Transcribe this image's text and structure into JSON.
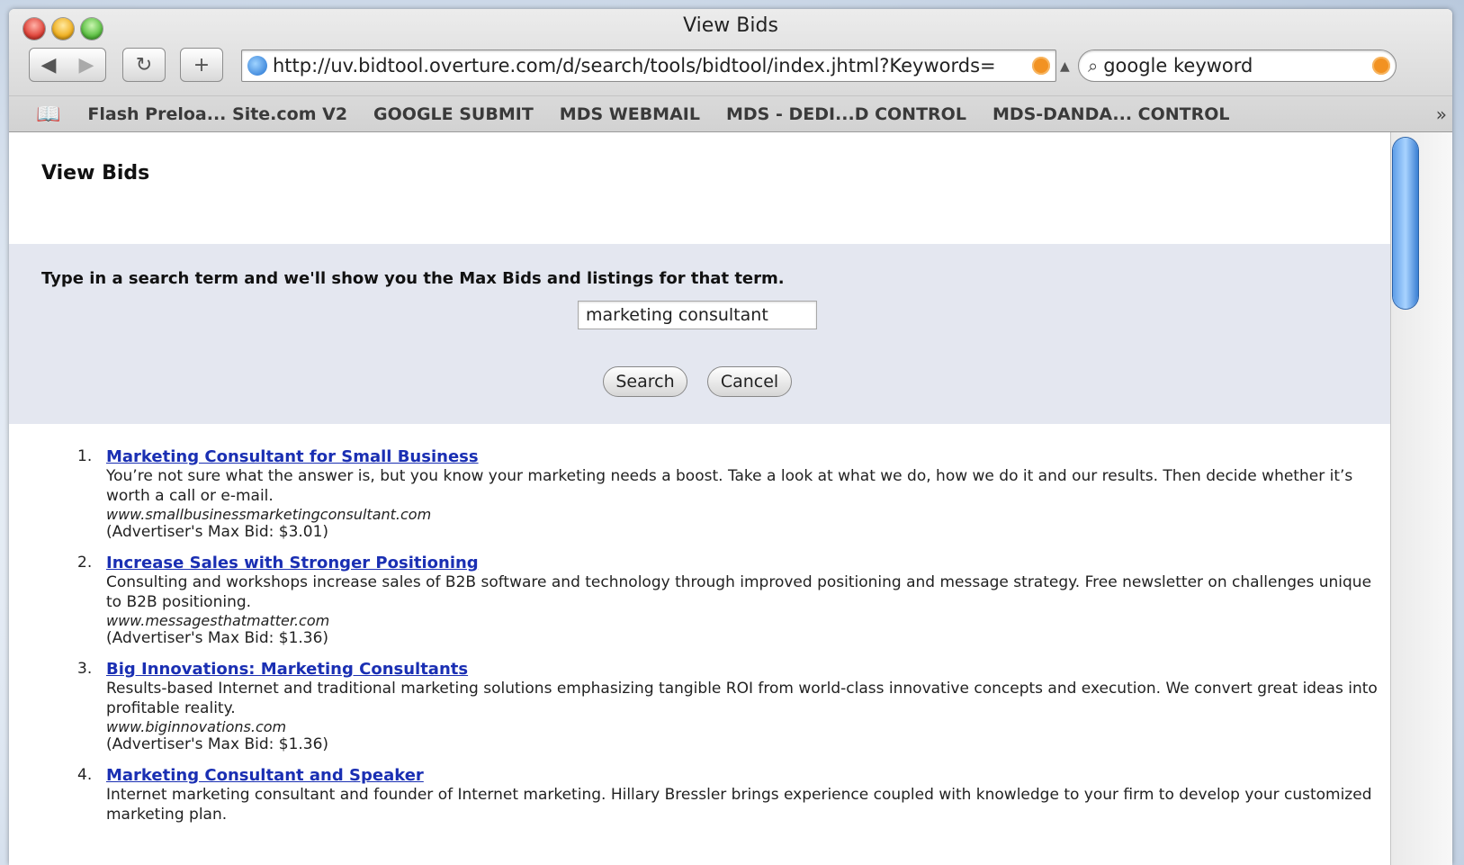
{
  "window": {
    "title": "View Bids"
  },
  "toolbar": {
    "url": "http://uv.bidtool.overture.com/d/search/tools/bidtool/index.jhtml?Keywords=",
    "search_value": "google keyword"
  },
  "bookmarks": [
    "Flash Preloa... Site.com V2",
    "GOOGLE SUBMIT",
    "MDS WEBMAIL",
    "MDS - DEDI...D CONTROL",
    "MDS-DANDA... CONTROL"
  ],
  "page": {
    "heading": "View Bids",
    "instructions": "Type in a search term and we'll show you the Max Bids and listings for that term.",
    "keyword_value": "marketing consultant",
    "search_label": "Search",
    "cancel_label": "Cancel"
  },
  "results": [
    {
      "num": "1.",
      "title": "Marketing Consultant for Small Business",
      "desc": "You’re not sure what the answer is, but you know your marketing needs a boost. Take a look at what we do, how we do it and our results. Then decide whether it’s worth a call or e-mail.",
      "url": "www.smallbusinessmarketingconsultant.com",
      "bid": "(Advertiser's Max Bid: $3.01)"
    },
    {
      "num": "2.",
      "title": "Increase Sales with Stronger Positioning",
      "desc": "Consulting and workshops increase sales of B2B software and technology through improved positioning and message strategy. Free newsletter on challenges unique to B2B positioning.",
      "url": "www.messagesthatmatter.com",
      "bid": "(Advertiser's Max Bid: $1.36)"
    },
    {
      "num": "3.",
      "title": "Big Innovations: Marketing Consultants",
      "desc": "Results-based Internet and traditional marketing solutions emphasizing tangible ROI from world-class innovative concepts and execution. We convert great ideas into profitable reality.",
      "url": "www.biginnovations.com",
      "bid": "(Advertiser's Max Bid: $1.36)"
    },
    {
      "num": "4.",
      "title": "Marketing Consultant and Speaker",
      "desc": "Internet marketing consultant and founder of Internet marketing. Hillary Bressler brings experience coupled with knowledge to your firm to develop your customized marketing plan.",
      "url": "",
      "bid": ""
    }
  ]
}
